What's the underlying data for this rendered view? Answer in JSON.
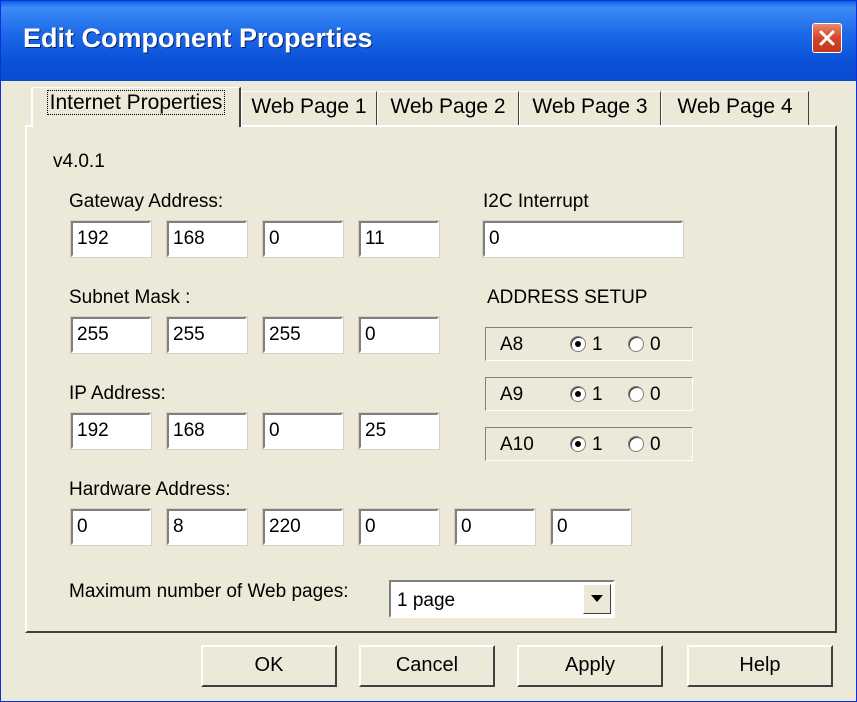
{
  "window": {
    "title": "Edit Component Properties"
  },
  "tabs": [
    {
      "label": "Internet Properties"
    },
    {
      "label": "Web Page 1"
    },
    {
      "label": "Web Page 2"
    },
    {
      "label": "Web Page 3"
    },
    {
      "label": "Web Page 4"
    }
  ],
  "version": "v4.0.1",
  "gateway": {
    "label": "Gateway Address:",
    "octets": [
      "192",
      "168",
      "0",
      "11"
    ]
  },
  "subnet": {
    "label": "Subnet Mask :",
    "octets": [
      "255",
      "255",
      "255",
      "0"
    ]
  },
  "ip": {
    "label": "IP Address:",
    "octets": [
      "192",
      "168",
      "0",
      "25"
    ]
  },
  "hardware": {
    "label": "Hardware Address:",
    "octets": [
      "0",
      "8",
      "220",
      "0",
      "0",
      "0"
    ]
  },
  "i2c": {
    "label": "I2C Interrupt",
    "value": "0"
  },
  "address_setup": {
    "title": "ADDRESS SETUP",
    "rows": [
      {
        "name": "A8",
        "opt1": "1",
        "opt0": "0",
        "selected": "1"
      },
      {
        "name": "A9",
        "opt1": "1",
        "opt0": "0",
        "selected": "1"
      },
      {
        "name": "A10",
        "opt1": "1",
        "opt0": "0",
        "selected": "1"
      }
    ]
  },
  "max_pages": {
    "label": "Maximum number of Web pages:",
    "value": "1 page"
  },
  "buttons": {
    "ok": "OK",
    "cancel": "Cancel",
    "apply": "Apply",
    "help": "Help"
  }
}
